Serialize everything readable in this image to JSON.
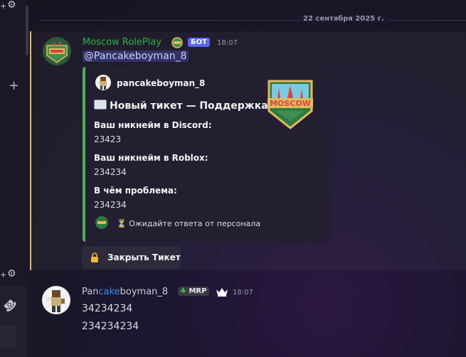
{
  "divider": {
    "date": "22 сентября 2025 г."
  },
  "message1": {
    "author": "Moscow RolePlay",
    "badge": "БОТ",
    "time": "18:07",
    "mention": "@Pancakeboyman_8",
    "embed": {
      "author": "pancakeboyman_8",
      "title": "Новый тикет — Поддержка",
      "fields": [
        {
          "name": "Ваш никнейм в Discord:",
          "value": "23423"
        },
        {
          "name": "Ваш никнейм в Roblox:",
          "value": "234234"
        },
        {
          "name": "В чём проблема:",
          "value": "234234"
        }
      ],
      "footer": "⏳ Ожидайте ответа от персонала",
      "accent_color": "#4fb04f",
      "thumbnail_text": "MOSCOW"
    },
    "button": {
      "icon": "lock-icon",
      "label": "Закрыть Тикет"
    }
  },
  "message2": {
    "author_parts": [
      "Pan",
      "cake",
      "boyman_8"
    ],
    "badge": "MRP",
    "time": "18:07",
    "lines": [
      "34234234",
      "234234234"
    ]
  },
  "colors": {
    "bot_name": "#2fb14a",
    "badge": "#5865f2",
    "highlight_bar": "#e4b862",
    "cake": "#3a8df0"
  }
}
